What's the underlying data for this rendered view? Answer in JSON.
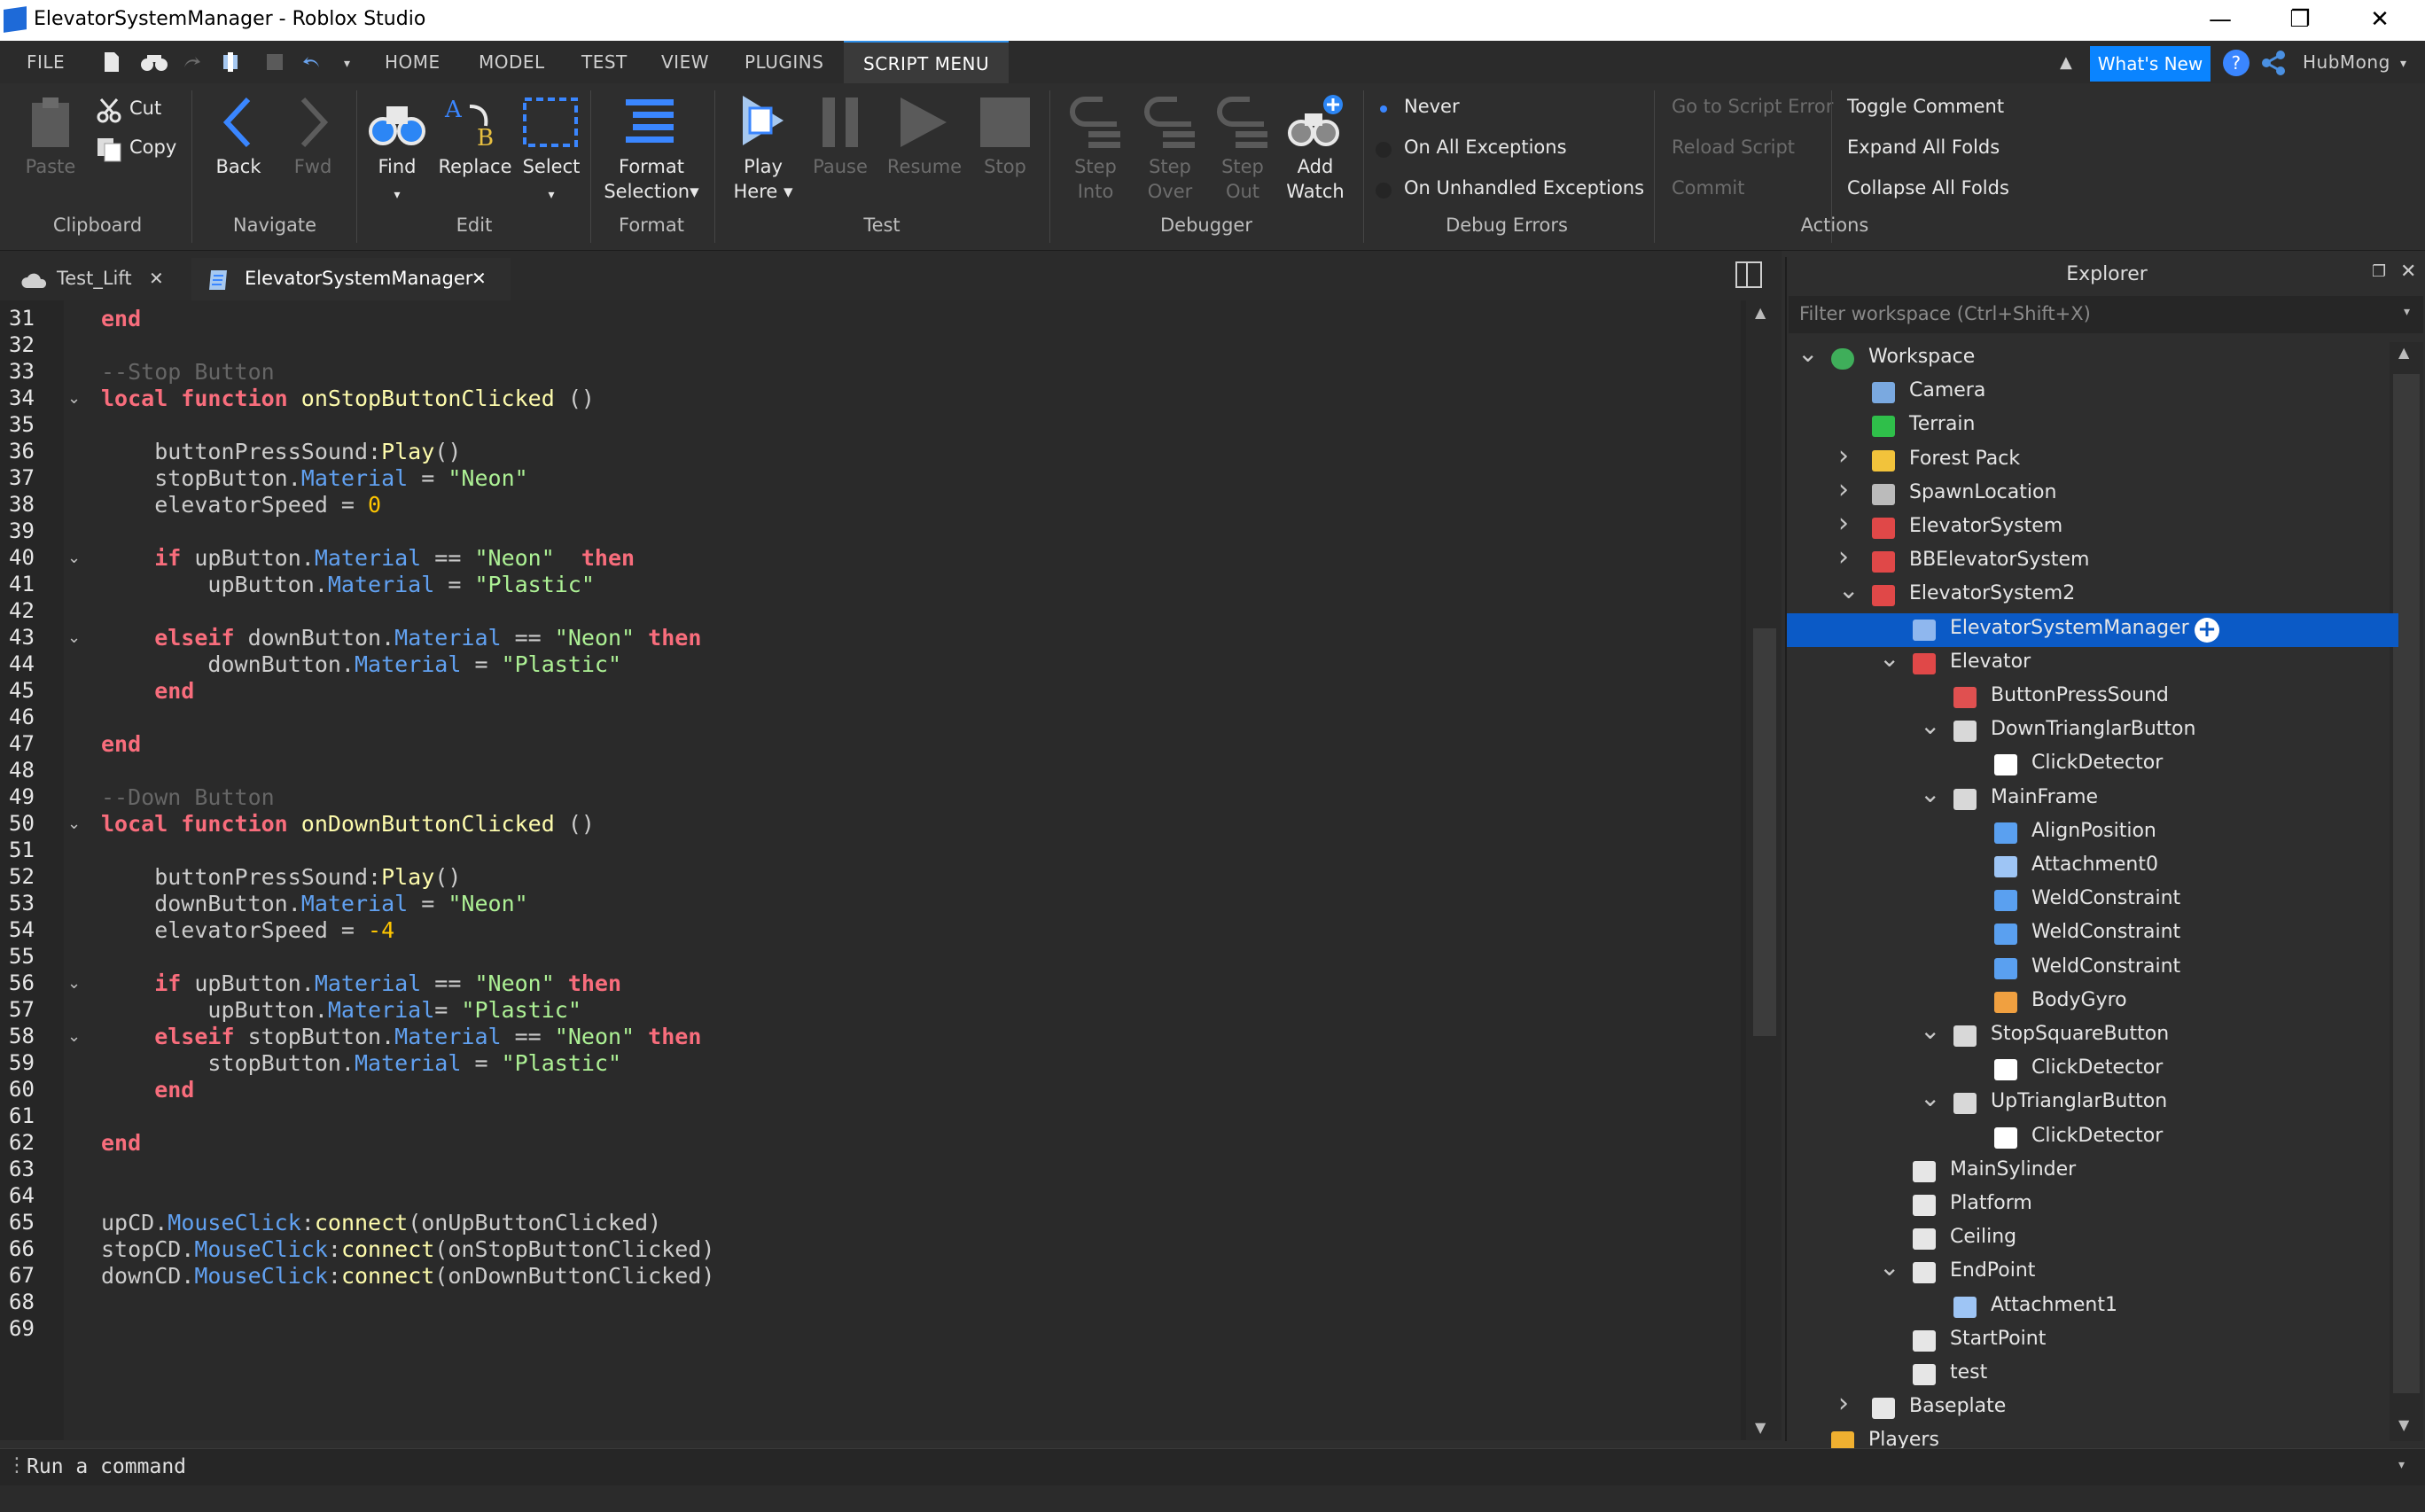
{
  "window": {
    "title": "ElevatorSystemManager - Roblox Studio",
    "minimize": "—",
    "maximize": "❐",
    "close": "✕"
  },
  "menubar": {
    "file": "FILE",
    "tabs": [
      "HOME",
      "MODEL",
      "TEST",
      "VIEW",
      "PLUGINS",
      "SCRIPT MENU"
    ],
    "whats_new": "What's New",
    "user": "HubMong"
  },
  "ribbon": {
    "clipboard": {
      "paste": "Paste",
      "cut": "Cut",
      "copy": "Copy",
      "group": "Clipboard"
    },
    "navigate": {
      "back": "Back",
      "fwd": "Fwd",
      "group": "Navigate"
    },
    "edit": {
      "find": "Find",
      "replace": "Replace",
      "select": "Select",
      "group": "Edit"
    },
    "format": {
      "label1": "Format",
      "label2": "Selection",
      "group": "Format"
    },
    "test": {
      "play1": "Play",
      "play2": "Here",
      "pause": "Pause",
      "resume": "Resume",
      "stop": "Stop",
      "group": "Test"
    },
    "debugger": {
      "step_into1": "Step",
      "step_into2": "Into",
      "step_over1": "Step",
      "step_over2": "Over",
      "step_out1": "Step",
      "step_out2": "Out",
      "add_watch1": "Add",
      "add_watch2": "Watch",
      "group": "Debugger"
    },
    "debug_errors": {
      "never": "Never",
      "all": "On All Exceptions",
      "unhandled": "On Unhandled Exceptions",
      "group": "Debug Errors"
    },
    "actions": {
      "goto": "Go to Script Error",
      "reload": "Reload Script",
      "commit": "Commit",
      "toggle_comment": "Toggle Comment",
      "expand": "Expand All Folds",
      "collapse": "Collapse All Folds",
      "group": "Actions"
    }
  },
  "tabs": [
    {
      "label": "Test_Lift"
    },
    {
      "label": "ElevatorSystemManager"
    }
  ],
  "editor": {
    "line_numbers": [
      "31",
      "32",
      "33",
      "34",
      "35",
      "36",
      "37",
      "38",
      "39",
      "40",
      "41",
      "42",
      "43",
      "44",
      "45",
      "46",
      "47",
      "48",
      "49",
      "50",
      "51",
      "52",
      "53",
      "54",
      "55",
      "56",
      "57",
      "58",
      "59",
      "60",
      "61",
      "62",
      "63",
      "64",
      "65",
      "66",
      "67",
      "68",
      "69"
    ],
    "fold_lines": [
      "34",
      "40",
      "43",
      "50",
      "56",
      "58"
    ],
    "lines": [
      [
        [
          "kw",
          "end"
        ]
      ],
      [],
      [
        [
          "cm",
          "--Stop Button"
        ]
      ],
      [
        [
          "kw",
          "local function "
        ],
        [
          "fn",
          "onStopButtonClicked"
        ],
        [
          "op",
          " ()"
        ]
      ],
      [],
      [
        [
          "op",
          "    buttonPressSound:"
        ],
        [
          "fn",
          "Play"
        ],
        [
          "op",
          "()"
        ]
      ],
      [
        [
          "op",
          "    stopButton."
        ],
        [
          "prop",
          "Material"
        ],
        [
          "op",
          " = "
        ],
        [
          "str",
          "\"Neon\""
        ]
      ],
      [
        [
          "op",
          "    elevatorSpeed = "
        ],
        [
          "num",
          "0"
        ]
      ],
      [],
      [
        [
          "kw",
          "    if "
        ],
        [
          "op",
          "upButton."
        ],
        [
          "prop",
          "Material"
        ],
        [
          "op",
          " == "
        ],
        [
          "str",
          "\"Neon\""
        ],
        [
          "kw",
          "  then"
        ]
      ],
      [
        [
          "op",
          "        upButton."
        ],
        [
          "prop",
          "Material"
        ],
        [
          "op",
          " = "
        ],
        [
          "str",
          "\"Plastic\""
        ]
      ],
      [],
      [
        [
          "kw",
          "    elseif "
        ],
        [
          "op",
          "downButton."
        ],
        [
          "prop",
          "Material"
        ],
        [
          "op",
          " == "
        ],
        [
          "str",
          "\"Neon\""
        ],
        [
          "kw",
          " then"
        ]
      ],
      [
        [
          "op",
          "        downButton."
        ],
        [
          "prop",
          "Material"
        ],
        [
          "op",
          " = "
        ],
        [
          "str",
          "\"Plastic\""
        ]
      ],
      [
        [
          "kw",
          "    end"
        ]
      ],
      [],
      [
        [
          "kw",
          "end"
        ]
      ],
      [],
      [
        [
          "cm",
          "--Down Button"
        ]
      ],
      [
        [
          "kw",
          "local function "
        ],
        [
          "fn",
          "onDownButtonClicked"
        ],
        [
          "op",
          " ()"
        ]
      ],
      [],
      [
        [
          "op",
          "    buttonPressSound:"
        ],
        [
          "fn",
          "Play"
        ],
        [
          "op",
          "()"
        ]
      ],
      [
        [
          "op",
          "    downButton."
        ],
        [
          "prop",
          "Material"
        ],
        [
          "op",
          " = "
        ],
        [
          "str",
          "\"Neon\""
        ]
      ],
      [
        [
          "op",
          "    elevatorSpeed = "
        ],
        [
          "num",
          "-4"
        ]
      ],
      [],
      [
        [
          "kw",
          "    if "
        ],
        [
          "op",
          "upButton."
        ],
        [
          "prop",
          "Material"
        ],
        [
          "op",
          " == "
        ],
        [
          "str",
          "\"Neon\""
        ],
        [
          "kw",
          " then"
        ]
      ],
      [
        [
          "op",
          "        upButton."
        ],
        [
          "prop",
          "Material"
        ],
        [
          "op",
          "= "
        ],
        [
          "str",
          "\"Plastic\""
        ]
      ],
      [
        [
          "kw",
          "    elseif "
        ],
        [
          "op",
          "stopButton."
        ],
        [
          "prop",
          "Material"
        ],
        [
          "op",
          " == "
        ],
        [
          "str",
          "\"Neon\""
        ],
        [
          "kw",
          " then"
        ]
      ],
      [
        [
          "op",
          "        stopButton."
        ],
        [
          "prop",
          "Material"
        ],
        [
          "op",
          " = "
        ],
        [
          "str",
          "\"Plastic\""
        ]
      ],
      [
        [
          "kw",
          "    end"
        ]
      ],
      [],
      [
        [
          "kw",
          "end"
        ]
      ],
      [],
      [],
      [
        [
          "op",
          "upCD."
        ],
        [
          "prop",
          "MouseClick"
        ],
        [
          "op",
          ":"
        ],
        [
          "fn",
          "connect"
        ],
        [
          "op",
          "(onUpButtonClicked)"
        ]
      ],
      [
        [
          "op",
          "stopCD."
        ],
        [
          "prop",
          "MouseClick"
        ],
        [
          "op",
          ":"
        ],
        [
          "fn",
          "connect"
        ],
        [
          "op",
          "(onStopButtonClicked)"
        ]
      ],
      [
        [
          "op",
          "downCD."
        ],
        [
          "prop",
          "MouseClick"
        ],
        [
          "op",
          ":"
        ],
        [
          "fn",
          "connect"
        ],
        [
          "op",
          "(onDownButtonClicked)"
        ]
      ],
      [],
      []
    ]
  },
  "explorer": {
    "title": "Explorer",
    "filter_placeholder": "Filter workspace (Ctrl+Shift+X)",
    "items": [
      {
        "label": "Workspace",
        "depth": 0,
        "chevron": "down",
        "icon": "workspace-icon"
      },
      {
        "label": "Camera",
        "depth": 1,
        "chevron": "",
        "icon": "camera-icon"
      },
      {
        "label": "Terrain",
        "depth": 1,
        "chevron": "",
        "icon": "terrain-icon"
      },
      {
        "label": "Forest Pack",
        "depth": 1,
        "chevron": "right",
        "icon": "folder-icon"
      },
      {
        "label": "SpawnLocation",
        "depth": 1,
        "chevron": "right",
        "icon": "spawn-icon"
      },
      {
        "label": "ElevatorSystem",
        "depth": 1,
        "chevron": "right",
        "icon": "model-icon"
      },
      {
        "label": "BBElevatorSystem",
        "depth": 1,
        "chevron": "right",
        "icon": "model-icon"
      },
      {
        "label": "ElevatorSystem2",
        "depth": 1,
        "chevron": "down",
        "icon": "model-icon"
      },
      {
        "label": "ElevatorSystemManager",
        "depth": 2,
        "chevron": "",
        "icon": "script-icon",
        "selected": true
      },
      {
        "label": "Elevator",
        "depth": 2,
        "chevron": "down",
        "icon": "model-icon"
      },
      {
        "label": "ButtonPressSound",
        "depth": 3,
        "chevron": "",
        "icon": "sound-icon"
      },
      {
        "label": "DownTrianglarButton",
        "depth": 3,
        "chevron": "down",
        "icon": "union-icon"
      },
      {
        "label": "ClickDetector",
        "depth": 4,
        "chevron": "",
        "icon": "clickdetector-icon"
      },
      {
        "label": "MainFrame",
        "depth": 3,
        "chevron": "down",
        "icon": "union-icon"
      },
      {
        "label": "AlignPosition",
        "depth": 4,
        "chevron": "",
        "icon": "alignposition-icon"
      },
      {
        "label": "Attachment0",
        "depth": 4,
        "chevron": "",
        "icon": "attachment-icon"
      },
      {
        "label": "WeldConstraint",
        "depth": 4,
        "chevron": "",
        "icon": "weld-icon"
      },
      {
        "label": "WeldConstraint",
        "depth": 4,
        "chevron": "",
        "icon": "weld-icon"
      },
      {
        "label": "WeldConstraint",
        "depth": 4,
        "chevron": "",
        "icon": "weld-icon"
      },
      {
        "label": "BodyGyro",
        "depth": 4,
        "chevron": "",
        "icon": "bodygyro-icon"
      },
      {
        "label": "StopSquareButton",
        "depth": 3,
        "chevron": "down",
        "icon": "union-icon"
      },
      {
        "label": "ClickDetector",
        "depth": 4,
        "chevron": "",
        "icon": "clickdetector-icon"
      },
      {
        "label": "UpTrianglarButton",
        "depth": 3,
        "chevron": "down",
        "icon": "union-icon"
      },
      {
        "label": "ClickDetector",
        "depth": 4,
        "chevron": "",
        "icon": "clickdetector-icon"
      },
      {
        "label": "MainSylinder",
        "depth": 2,
        "chevron": "",
        "icon": "part-icon"
      },
      {
        "label": "Platform",
        "depth": 2,
        "chevron": "",
        "icon": "part-icon"
      },
      {
        "label": "Ceiling",
        "depth": 2,
        "chevron": "",
        "icon": "part-icon"
      },
      {
        "label": "EndPoint",
        "depth": 2,
        "chevron": "down",
        "icon": "part-icon"
      },
      {
        "label": "Attachment1",
        "depth": 3,
        "chevron": "",
        "icon": "attachment-icon"
      },
      {
        "label": "StartPoint",
        "depth": 2,
        "chevron": "",
        "icon": "part-icon"
      },
      {
        "label": "test",
        "depth": 2,
        "chevron": "",
        "icon": "part-icon"
      },
      {
        "label": "Baseplate",
        "depth": 1,
        "chevron": "right",
        "icon": "part-icon"
      },
      {
        "label": "Players",
        "depth": 0,
        "chevron": "",
        "icon": "players-icon"
      }
    ]
  },
  "command_bar": {
    "placeholder": "Run a command"
  },
  "colors": {
    "accent": "#0b5ac6",
    "whats_new": "#0a84ff",
    "keyword": "#f86d7c",
    "string": "#adf195",
    "property": "#61a1f1",
    "number": "#ffc600",
    "function": "#fdfbac",
    "comment": "#666666"
  }
}
